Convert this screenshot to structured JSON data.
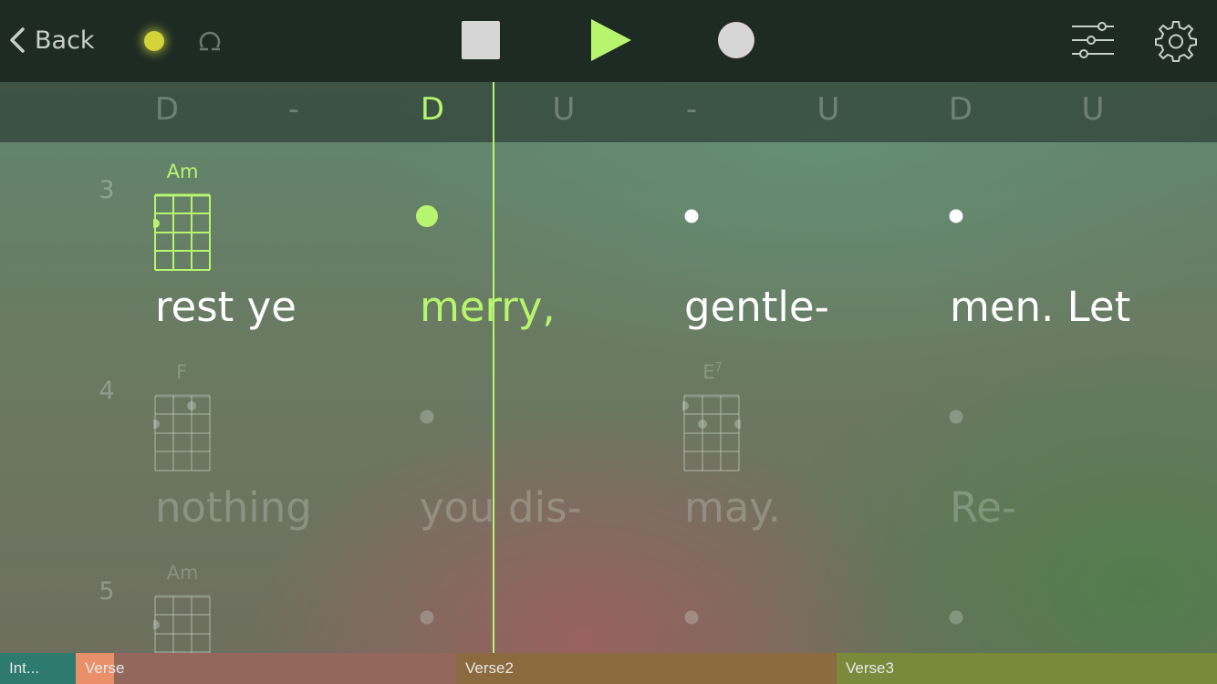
{
  "toolbar": {
    "back_label": "Back",
    "icons": [
      "chevron-left-icon",
      "metronome-icon",
      "loop-icon",
      "stop-icon",
      "play-icon",
      "record-icon",
      "mixer-icon",
      "gear-icon"
    ],
    "accent_color": "#b7f56e",
    "metronome_color": "#d3d43a"
  },
  "strum_pattern": [
    "D",
    "-",
    "D",
    "U",
    "-",
    "U",
    "D",
    "U"
  ],
  "active_strum_index": 2,
  "rows": [
    {
      "bar": "3",
      "chords": [
        {
          "name": "Am",
          "state": "active"
        }
      ],
      "lyrics": [
        "rest ye",
        "merry,",
        "gentle-",
        "men. Let"
      ]
    },
    {
      "bar": "4",
      "chords": [
        {
          "name": "F",
          "state": "dim"
        },
        {
          "name": "E",
          "sup": "7",
          "state": "dim"
        }
      ],
      "lyrics": [
        "nothing",
        "you dis-",
        "may.",
        "Re-"
      ]
    },
    {
      "bar": "5",
      "chords": [
        {
          "name": "Am",
          "state": "dim"
        }
      ],
      "lyrics": []
    }
  ],
  "sections": [
    {
      "label": "Int...",
      "color": "#2e7a6e"
    },
    {
      "label": "Verse",
      "color": "#e9906a"
    },
    {
      "label": "Verse2",
      "color": "#8a6a3e"
    },
    {
      "label": "Verse3",
      "color": "#7a8a3a"
    }
  ]
}
